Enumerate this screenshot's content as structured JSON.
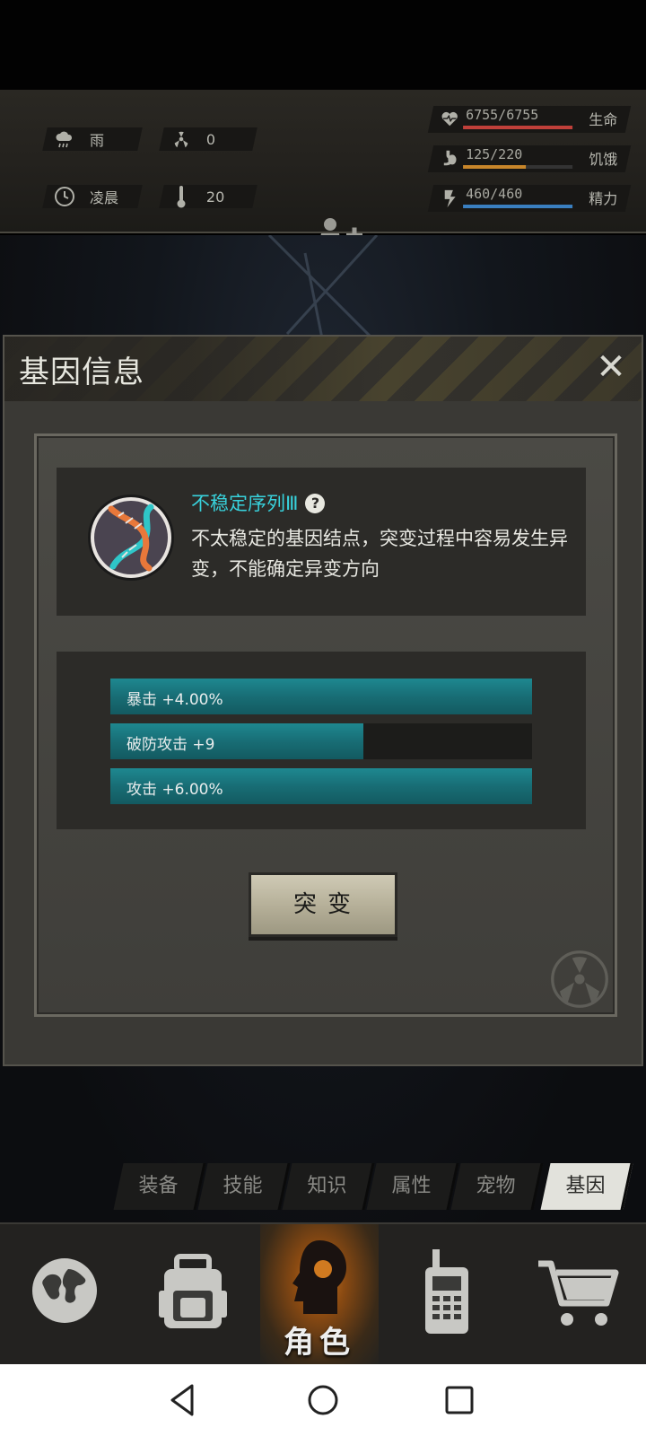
{
  "hud": {
    "weather": "雨",
    "radiation": "0",
    "time_of_day": "凌晨",
    "temperature": "20",
    "stats": [
      {
        "name": "生命",
        "value": "6755/6755",
        "fill": 1.0,
        "color": "#c0403a",
        "icon": "heart-icon"
      },
      {
        "name": "饥饿",
        "value": "125/220",
        "fill": 0.57,
        "color": "#c8862a",
        "icon": "stomach-icon"
      },
      {
        "name": "精力",
        "value": "460/460",
        "fill": 1.0,
        "color": "#3a7fc0",
        "icon": "energy-icon"
      }
    ]
  },
  "dialog": {
    "title": "基因信息",
    "gene_name": "不稳定序列Ⅲ",
    "gene_desc": "不太稳定的基因结点，突变过程中容易发生异变，不能确定异变方向",
    "attributes": [
      {
        "label": "暴击 +4.00%",
        "fill": 1.0
      },
      {
        "label": "破防攻击 +9",
        "fill": 0.6
      },
      {
        "label": "攻击 +6.00%",
        "fill": 1.0
      }
    ],
    "mutate_label": "突变"
  },
  "tabs": [
    "装备",
    "技能",
    "知识",
    "属性",
    "宠物",
    "基因"
  ],
  "active_tab": "基因",
  "nav": {
    "items": [
      "globe-icon",
      "backpack-icon",
      "character-icon",
      "radio-icon",
      "cart-icon"
    ],
    "active_label": "角色"
  }
}
